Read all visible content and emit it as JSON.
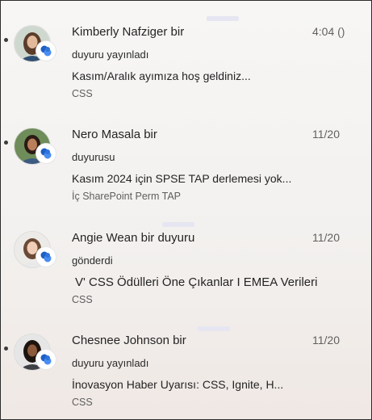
{
  "feed": {
    "items": [
      {
        "author": "Kimberly Nafziger bir",
        "action": "duyuru yayınladı",
        "title": "Kasım/Aralık ayımıza hoş geldiniz...",
        "source": "CSS",
        "time": "4:04 ()",
        "avatar": "avatar-kimberly",
        "app_icon": "viva-engage-icon"
      },
      {
        "author": "Nero  Masala bir",
        "action": "duyurusu",
        "title": "Kasım 2024 için SPSE TAP derlemesi yok...",
        "source": "İç SharePoint Perm TAP",
        "time": "11/20",
        "avatar": "avatar-nero",
        "app_icon": "viva-engage-icon"
      },
      {
        "author": "Angie Wean bir duyuru",
        "action": "gönderdi",
        "title": "V' CSS Ödülleri Öne Çıkanlar I EMEA Verileri",
        "source": "CSS",
        "time": "11/20",
        "avatar": "avatar-angie",
        "app_icon": "viva-engage-icon"
      },
      {
        "author": "Chesnee Johnson bir",
        "action": "duyuru yayınladı",
        "title": "İnovasyon    Haber Uyarısı: CSS, Ignite, H...",
        "source": "CSS",
        "time": "11/20",
        "avatar": "avatar-chesnee",
        "app_icon": "viva-engage-icon"
      }
    ]
  },
  "colors": {
    "badge_blue": "#1e5fc4",
    "badge_light": "#4a8df0",
    "unread_dot": "#3b3b3b"
  }
}
